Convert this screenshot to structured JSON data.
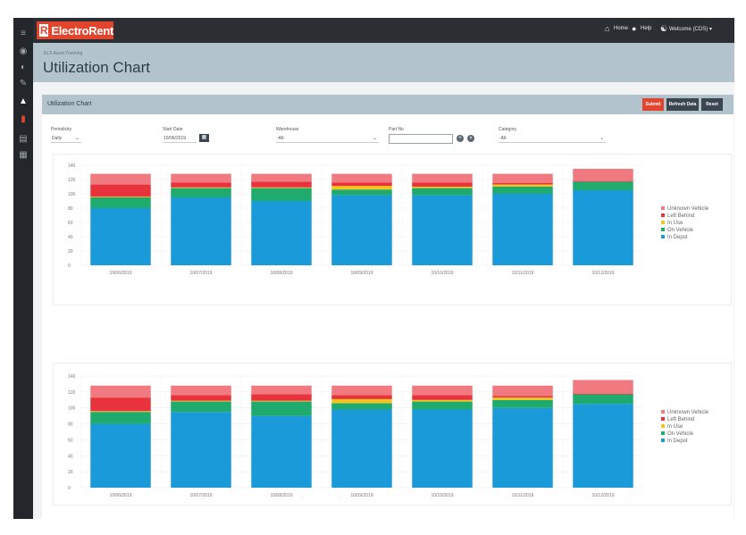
{
  "topbar": {
    "logo_text": "ElectroRent",
    "home_label": "Home",
    "help_label": "Help",
    "welcome_label": "Welcome (CDS) ▾"
  },
  "header": {
    "breadcrumb": "ELS Asset Tracking",
    "title": "Utilization Chart"
  },
  "panel": {
    "title": "Utilization Chart",
    "submit_label": "Submit",
    "refresh_label": "Refresh Data",
    "reset_label": "Reset"
  },
  "filters": {
    "periodicity": {
      "label": "Periodicity",
      "value": "Daily"
    },
    "start_date": {
      "label": "Start Date",
      "value": "10/06/2019"
    },
    "warehouse": {
      "label": "Warehouse",
      "value": "-All-"
    },
    "part_no": {
      "label": "Part No",
      "value": ""
    },
    "category": {
      "label": "Category",
      "value": "-All-"
    }
  },
  "colors": {
    "unknown_vehicle": "#f07a80",
    "left_behind": "#e8323c",
    "in_use": "#f5c518",
    "on_vehicle": "#1faa6e",
    "in_depot": "#1a9ad8",
    "accent": "#e2452d"
  },
  "chart_data": [
    {
      "type": "bar",
      "stacked": true,
      "categories": [
        "10/06/2019",
        "10/07/2019",
        "10/08/2019",
        "10/09/2019",
        "10/10/2019",
        "10/11/2019",
        "10/12/2019"
      ],
      "ylim": [
        0,
        140
      ],
      "yticks": [
        0,
        20,
        40,
        60,
        80,
        100,
        120,
        140
      ],
      "legend_position": "right",
      "series": [
        {
          "name": "In Depot",
          "color": "#1a9ad8",
          "values": [
            80,
            95,
            90,
            98,
            98,
            100,
            105
          ]
        },
        {
          "name": "On Vehicle",
          "color": "#1faa6e",
          "values": [
            15,
            13,
            18,
            8,
            10,
            10,
            12
          ]
        },
        {
          "name": "In Use",
          "color": "#f5c518",
          "values": [
            1,
            1,
            1,
            5,
            2,
            3,
            0
          ]
        },
        {
          "name": "Left Behind",
          "color": "#e8323c",
          "values": [
            17,
            7,
            8,
            5,
            6,
            2,
            1
          ]
        },
        {
          "name": "Unknown Vehicle",
          "color": "#f07a80",
          "values": [
            15,
            12,
            11,
            12,
            12,
            13,
            17
          ]
        }
      ]
    },
    {
      "type": "bar",
      "stacked": true,
      "categories": [
        "10/06/2019",
        "10/07/2019",
        "10/08/2019",
        "10/09/2019",
        "10/10/2019",
        "10/11/2019",
        "10/12/2019"
      ],
      "ylim": [
        0,
        140
      ],
      "yticks": [
        0,
        20,
        40,
        60,
        80,
        100,
        120,
        140
      ],
      "legend_position": "right",
      "series": [
        {
          "name": "In Depot",
          "color": "#1a9ad8",
          "values": [
            80,
            95,
            90,
            98,
            98,
            100,
            105
          ]
        },
        {
          "name": "On Vehicle",
          "color": "#1faa6e",
          "values": [
            15,
            13,
            18,
            8,
            10,
            10,
            12
          ]
        },
        {
          "name": "In Use",
          "color": "#f5c518",
          "values": [
            1,
            1,
            1,
            5,
            2,
            3,
            0
          ]
        },
        {
          "name": "Left Behind",
          "color": "#e8323c",
          "values": [
            17,
            7,
            8,
            5,
            6,
            2,
            1
          ]
        },
        {
          "name": "Unknown Vehicle",
          "color": "#f07a80",
          "values": [
            15,
            12,
            11,
            12,
            12,
            13,
            17
          ]
        }
      ]
    }
  ]
}
